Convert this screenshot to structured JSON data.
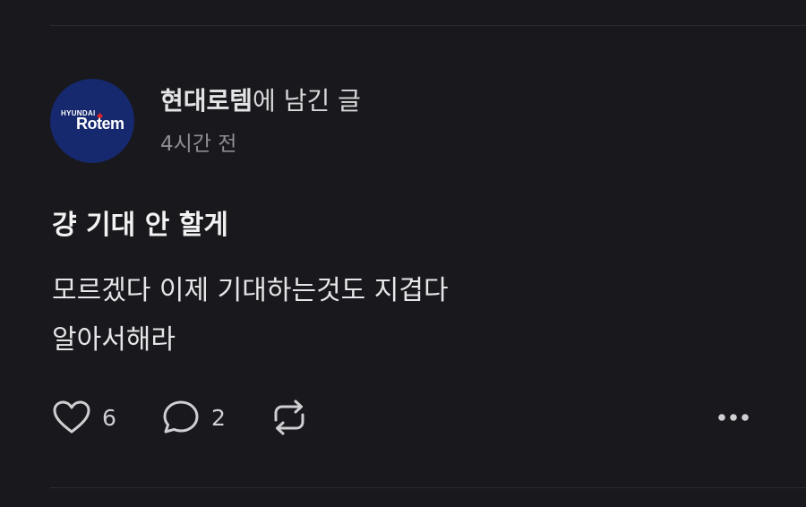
{
  "post": {
    "author": "현대로템",
    "header_suffix": "에 남긴 글",
    "timestamp": "4시간 전",
    "avatar": {
      "brand_small": "HYUNDAI",
      "brand_big": "Rotem",
      "background": "#16286e",
      "accent": "#d9242b"
    },
    "title": "걍 기대 안 할게",
    "body_lines": [
      "모르겠다 이제 기대하는것도 지겹다",
      "알아서해라"
    ]
  },
  "actions": {
    "like_icon": "heart-icon",
    "like_count": "6",
    "reply_icon": "speech-bubble-icon",
    "reply_count": "2",
    "repost_icon": "repost-arrows-icon",
    "more_icon": "more-dots-icon"
  },
  "theme": {
    "background": "#19181d",
    "divider": "#2c2b31"
  }
}
